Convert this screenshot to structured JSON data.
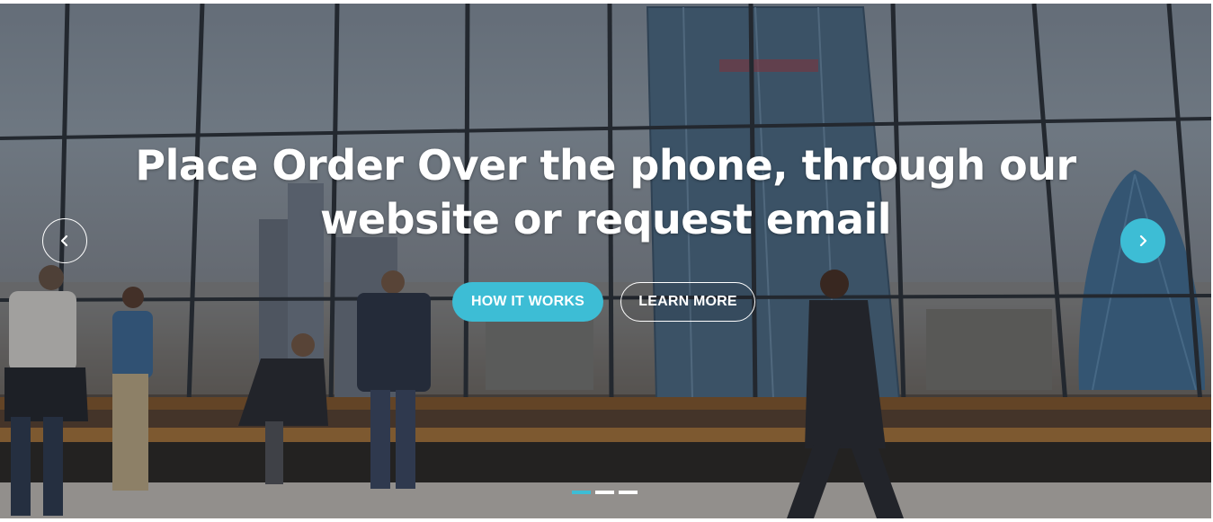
{
  "hero": {
    "headline_line1": "Place Order Over the phone, through our",
    "headline_line2": "website or request email",
    "primary_button": "HOW IT WORKS",
    "secondary_button": "LEARN MORE",
    "active_slide": 1,
    "slide_count": 3
  },
  "icons": {
    "prev": "chevron-left-icon",
    "next": "chevron-right-icon"
  },
  "colors": {
    "accent": "#3dbdd5",
    "text": "#ffffff"
  }
}
